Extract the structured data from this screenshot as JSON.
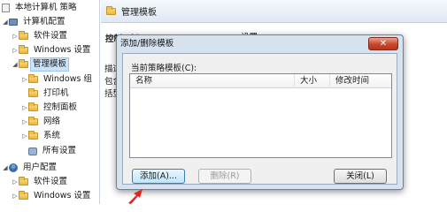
{
  "tree": {
    "root_label": "本地计算机 策略",
    "computer_config": "计算机配置",
    "software_settings": "软件设置",
    "windows_settings": "Windows 设置",
    "admin_templates": "管理模板",
    "windows_components": "Windows 组",
    "printers": "打印机",
    "control_panel": "控制面板",
    "network": "网络",
    "system": "系统",
    "all_settings": "所有设置",
    "user_config": "用户配置",
    "user_software_settings": "软件设置",
    "user_windows_settings": "Windows 设置"
  },
  "right_pane": {
    "header_title": "管理模板",
    "section_title": "控制面板",
    "setting_label": "设置",
    "desc_1": "描述",
    "desc_2": "包含",
    "desc_3": "括型"
  },
  "dialog": {
    "title": "添加/删除模板",
    "close_glyph": "✕",
    "list_label": "当前策略模板(C):",
    "columns": {
      "name": "名称",
      "size": "大小",
      "modified": "修改时间"
    },
    "buttons": {
      "add": "添加(A)...",
      "remove": "删除(R)",
      "close": "关闭(L)"
    }
  },
  "colors": {
    "pointer": "#e0261b",
    "selection": "#cde3f7",
    "dialog_frame": "#d7e2ef"
  },
  "icons": {
    "folder": "folder-icon",
    "computer": "computer-icon",
    "policy": "policy-document-icon",
    "user": "user-icon",
    "printer": "printer-icon",
    "arrow": "red-pointer-arrow"
  }
}
